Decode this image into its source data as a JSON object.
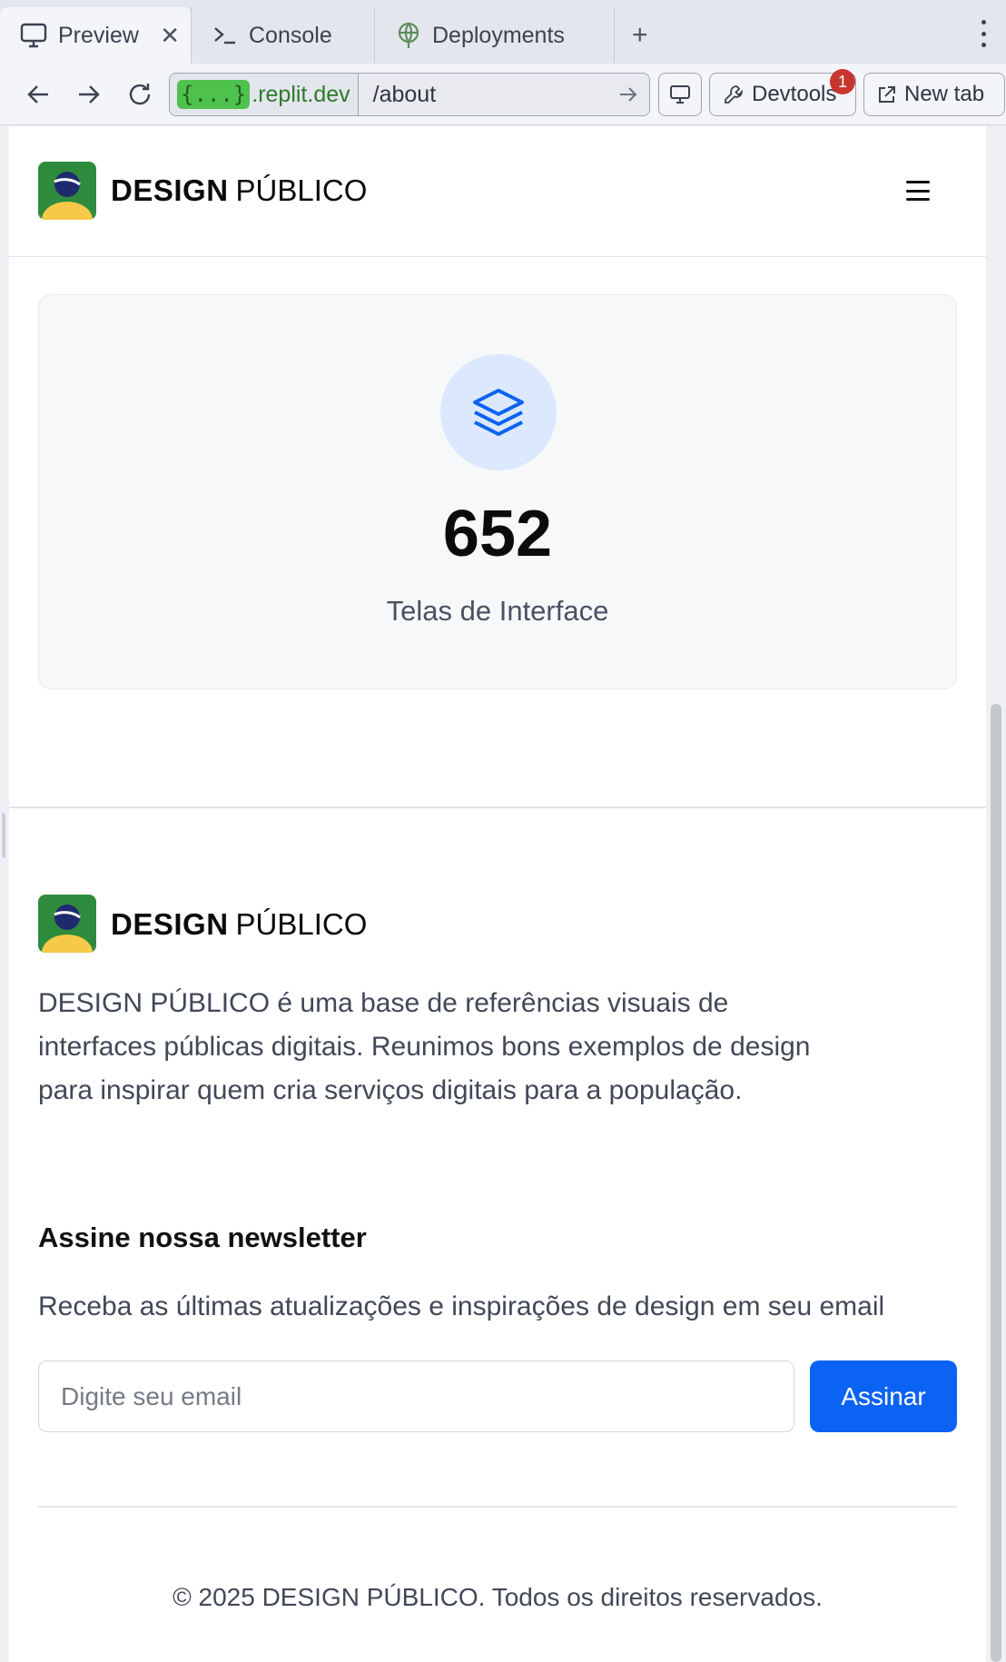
{
  "browser": {
    "tabs": [
      {
        "label": "Preview",
        "icon": "monitor-icon",
        "active": true
      },
      {
        "label": "Console",
        "icon": "terminal-icon",
        "active": false
      },
      {
        "label": "Deployments",
        "icon": "globe-icon",
        "active": false
      }
    ],
    "url": {
      "chip": "{...}",
      "domain": ".replit.dev",
      "path": "/about"
    },
    "buttons": {
      "devtools": "Devtools",
      "devtools_badge": "1",
      "new_tab": "New tab"
    }
  },
  "site": {
    "brand_bold": "DESIGN",
    "brand_light": "PÚBLICO",
    "colors": {
      "accent": "#0b63f3",
      "logo_green": "#2e8b3d",
      "logo_yellow": "#f7c948",
      "logo_navy": "#1f2a6e"
    }
  },
  "stat": {
    "icon": "layers-icon",
    "value": "652",
    "label": "Telas de Interface"
  },
  "footer": {
    "about": "DESIGN PÚBLICO é uma base de referências visuais de interfaces públicas digitais. Reunimos bons exemplos de design para inspirar quem cria serviços digitais para a população.",
    "newsletter_title": "Assine nossa newsletter",
    "newsletter_subtitle": "Receba as últimas atualizações e inspirações de design em seu email",
    "email_placeholder": "Digite seu email",
    "submit_label": "Assinar",
    "copyright": "© 2025 DESIGN PÚBLICO. Todos os direitos reservados."
  }
}
